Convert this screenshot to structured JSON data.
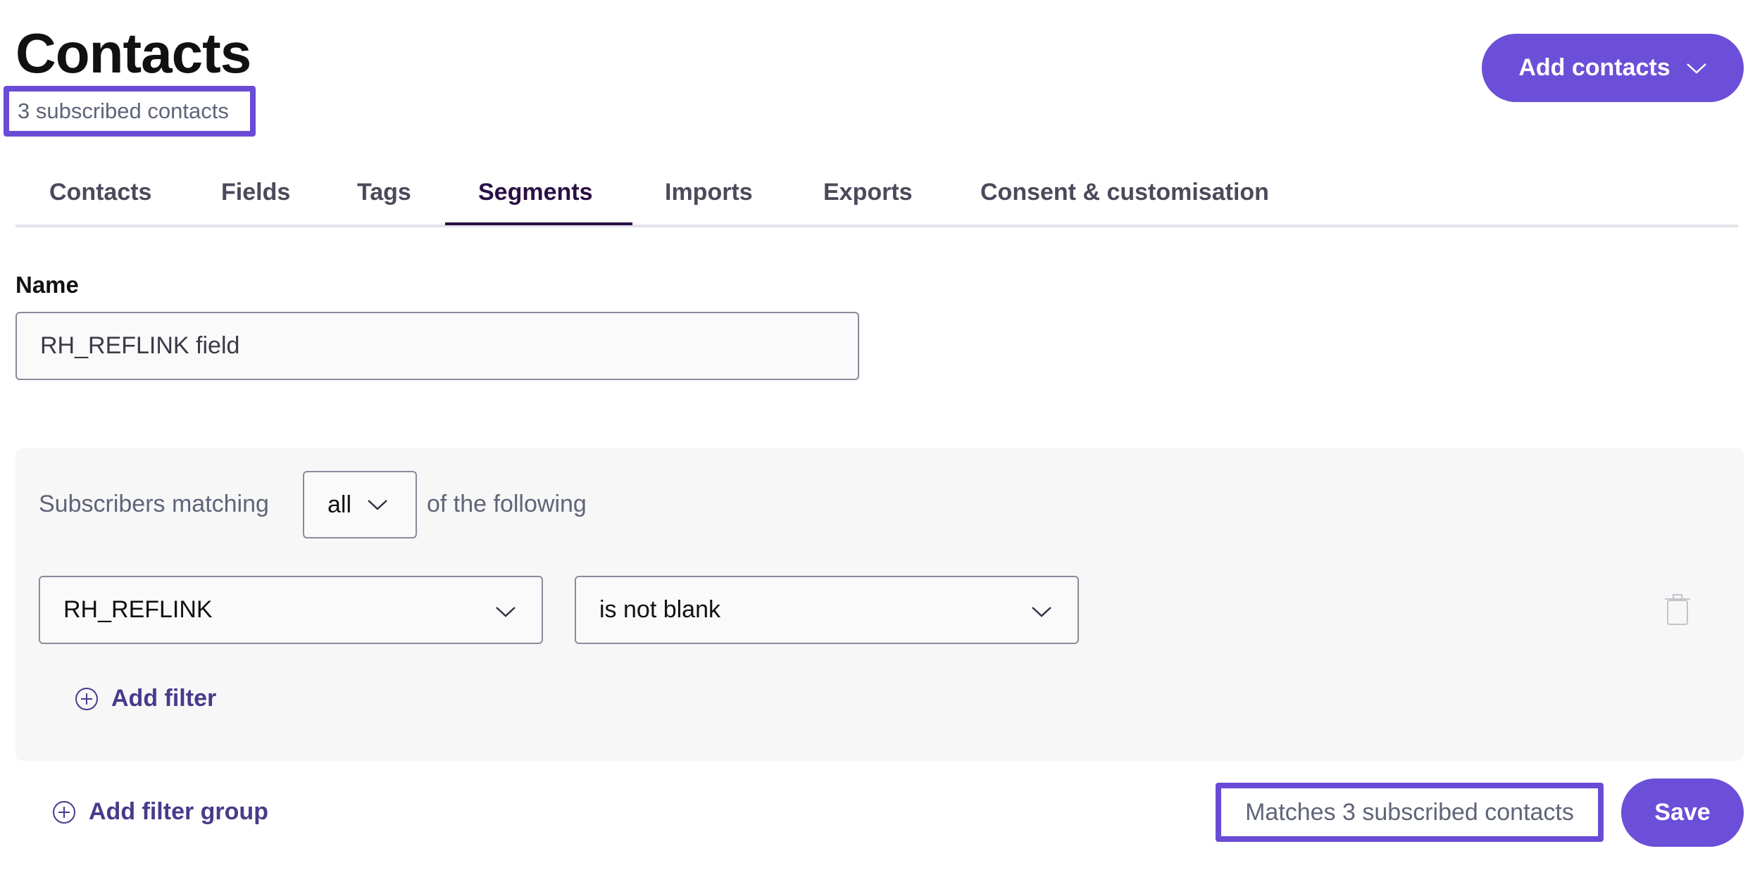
{
  "header": {
    "title": "Contacts",
    "subtitle": "3 subscribed contacts",
    "add_contacts_label": "Add contacts"
  },
  "tabs": [
    {
      "label": "Contacts"
    },
    {
      "label": "Fields"
    },
    {
      "label": "Tags"
    },
    {
      "label": "Segments",
      "active": true
    },
    {
      "label": "Imports"
    },
    {
      "label": "Exports"
    },
    {
      "label": "Consent & customisation"
    }
  ],
  "form": {
    "name_label": "Name",
    "name_value": "RH_REFLINK field"
  },
  "filters": {
    "matching_prefix": "Subscribers matching",
    "match_mode": "all",
    "matching_suffix": "of the following",
    "rules": [
      {
        "field": "RH_REFLINK",
        "condition": "is not blank"
      }
    ],
    "add_filter_label": "Add filter",
    "add_group_label": "Add filter group"
  },
  "footer": {
    "match_count_text": "Matches 3 subscribed contacts",
    "save_label": "Save"
  },
  "colors": {
    "accent": "#6b4fd8",
    "highlight_border": "#6a4bd6",
    "active_tab": "#2a0f45",
    "link": "#4a3a8a"
  },
  "icons": [
    "chevron-down-icon",
    "trash-icon",
    "plus-circle-icon"
  ]
}
